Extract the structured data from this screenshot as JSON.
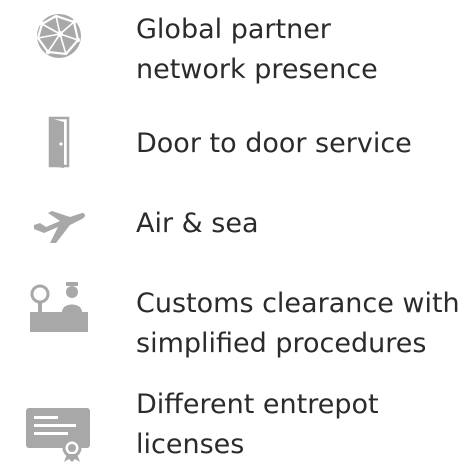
{
  "features": [
    {
      "icon": "globe-network-icon",
      "lines": [
        "Global partner",
        "network presence"
      ]
    },
    {
      "icon": "door-icon",
      "lines": [
        "Door to door service"
      ]
    },
    {
      "icon": "airplane-icon",
      "lines": [
        "Air & sea"
      ]
    },
    {
      "icon": "customs-officer-icon",
      "lines": [
        "Customs clearance with",
        "simplified procedures"
      ]
    },
    {
      "icon": "certificate-icon",
      "lines": [
        "Different entrepot",
        "licenses"
      ]
    }
  ],
  "colors": {
    "icon_gray": "#a8a8a8",
    "text": "#2b2b2b"
  }
}
